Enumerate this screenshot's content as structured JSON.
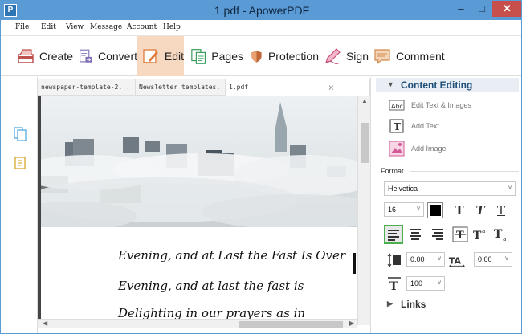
{
  "window": {
    "title": "1.pdf - ApowerPDF",
    "app_icon": "P",
    "min": "–",
    "max": "□",
    "close": "✕"
  },
  "menu": [
    "File",
    "Edit",
    "View",
    "Message",
    "Account",
    "Help"
  ],
  "toolbar": [
    {
      "label": "Create",
      "icon": "create-icon"
    },
    {
      "label": "Convert",
      "icon": "convert-icon"
    },
    {
      "label": "Edit",
      "icon": "edit-icon",
      "active": true
    },
    {
      "label": "Pages",
      "icon": "pages-icon"
    },
    {
      "label": "Protection",
      "icon": "shield-icon"
    },
    {
      "label": "Sign",
      "icon": "pen-icon"
    },
    {
      "label": "Comment",
      "icon": "comment-icon"
    }
  ],
  "tabs": [
    "newspaper-template-2...",
    "Newsletter templates...",
    "1.pdf"
  ],
  "tab_close": "×",
  "document": {
    "lines": [
      "Evening, and at Last the Fast Is Over",
      "Evening, and at last the fast is",
      "Delighting in our prayers as in"
    ]
  },
  "right_panel": {
    "content_editing": "Content Editing",
    "items": [
      "Edit Text & Images",
      "Add Text",
      "Add Image"
    ],
    "format_label": "Format",
    "font": "Helvetica",
    "font_size": "16",
    "line_spacing": "0.00",
    "char_spacing": "0.00",
    "scale": "100",
    "links": "Links"
  },
  "colors": {
    "accent": "#5b9bd5",
    "active_tool": "#f7d8c1",
    "close": "#c7504c"
  }
}
